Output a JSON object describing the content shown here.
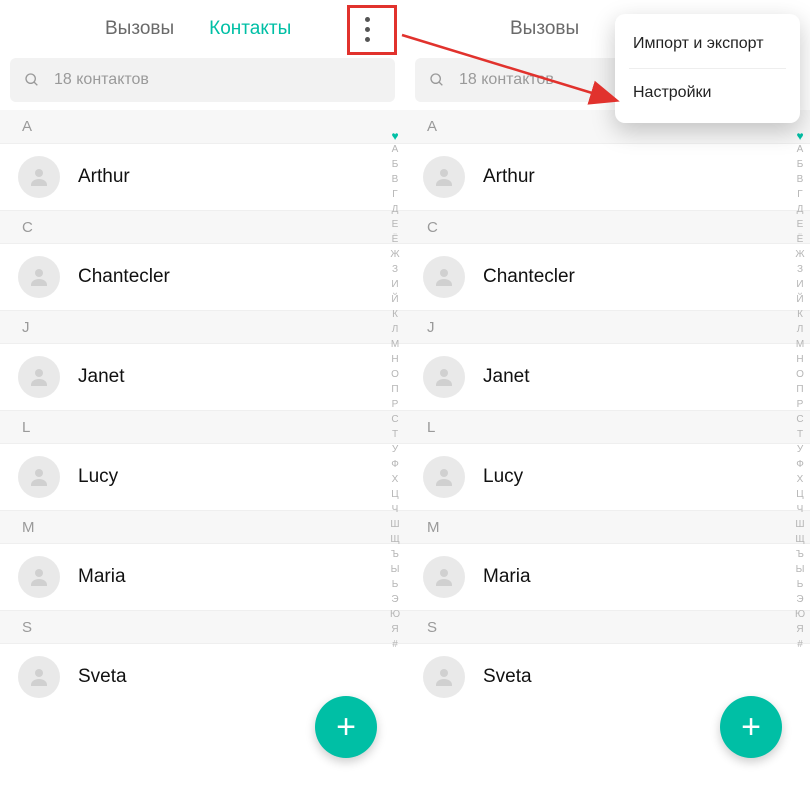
{
  "tabs": {
    "calls": "Вызовы",
    "contacts": "Контакты"
  },
  "search": {
    "placeholder": "18 контактов"
  },
  "sections": [
    {
      "letter": "A",
      "contacts": [
        "Arthur"
      ]
    },
    {
      "letter": "C",
      "contacts": [
        "Chantecler"
      ]
    },
    {
      "letter": "J",
      "contacts": [
        "Janet"
      ]
    },
    {
      "letter": "L",
      "contacts": [
        "Lucy"
      ]
    },
    {
      "letter": "M",
      "contacts": [
        "Maria"
      ]
    },
    {
      "letter": "S",
      "contacts": [
        "Sveta"
      ]
    }
  ],
  "index_letters": [
    "А",
    "Б",
    "В",
    "Г",
    "Д",
    "Е",
    "Ё",
    "Ж",
    "З",
    "И",
    "Й",
    "К",
    "Л",
    "М",
    "Н",
    "О",
    "П",
    "Р",
    "С",
    "Т",
    "У",
    "Ф",
    "Х",
    "Ц",
    "Ч",
    "Ш",
    "Щ",
    "Ъ",
    "Ы",
    "Ь",
    "Э",
    "Ю",
    "Я",
    "#"
  ],
  "popup": {
    "import_export": "Импорт и экспорт",
    "settings": "Настройки"
  },
  "colors": {
    "accent": "#00bfa5",
    "annotation": "#e1322d"
  }
}
